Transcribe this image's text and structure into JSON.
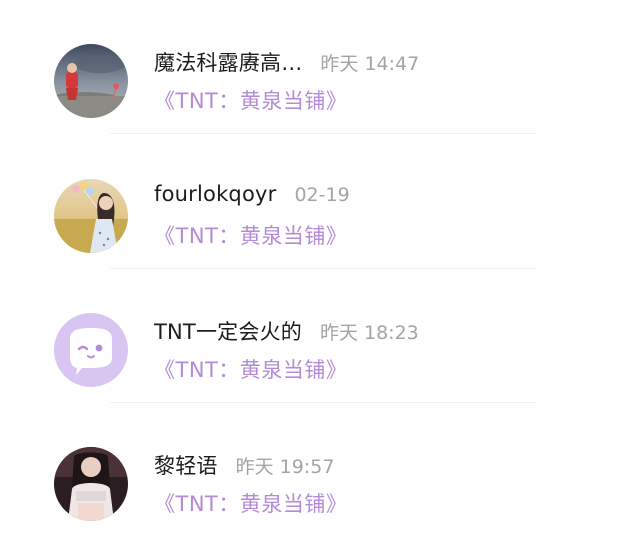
{
  "comments": [
    {
      "name": "魔法科露赓高…",
      "time": "昨天 14:47",
      "subtitle": "《TNT：黄泉当铺》",
      "avatar_icon": "photo-girl-red-dress-avatar"
    },
    {
      "name": "fourlokqoyr",
      "time": "02-19",
      "subtitle": "《TNT：黄泉当铺》",
      "avatar_icon": "photo-girl-balloons-field-avatar"
    },
    {
      "name": "TNT一定会火的",
      "time": "昨天 18:23",
      "subtitle": "《TNT：黄泉当铺》",
      "avatar_icon": "default-wink-face-avatar"
    },
    {
      "name": "黎轻语",
      "time": "昨天 19:57",
      "subtitle": "《TNT：黄泉当铺》",
      "avatar_icon": "photo-girl-white-top-avatar"
    }
  ],
  "colors": {
    "accent": "#b48bd6",
    "default_avatar_bg": "#d9c5f2",
    "name_text": "#1c1c1c",
    "time_text": "#a4a4a4"
  }
}
